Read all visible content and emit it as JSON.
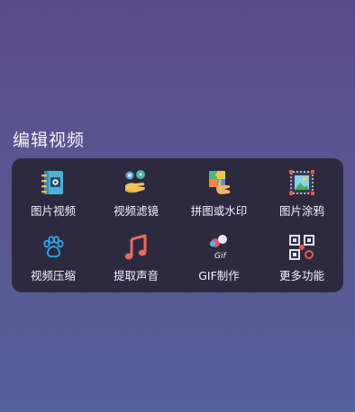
{
  "section": {
    "title": "编辑视频"
  },
  "tools": [
    {
      "label": "图片视频",
      "icon": "photo-album-icon"
    },
    {
      "label": "视频滤镜",
      "icon": "filter-hand-icon"
    },
    {
      "label": "拼图或水印",
      "icon": "puzzle-hand-icon"
    },
    {
      "label": "图片涂鸦",
      "icon": "framed-picture-icon"
    },
    {
      "label": "视频压缩",
      "icon": "paw-icon"
    },
    {
      "label": "提取声音",
      "icon": "music-note-icon"
    },
    {
      "label": "GIF制作",
      "icon": "gif-icon"
    },
    {
      "label": "更多功能",
      "icon": "qr-code-icon"
    }
  ],
  "gif_icon_text": "Gif",
  "colors": {
    "background_top": "#5a4a8c",
    "background_bottom": "#53609a",
    "panel": "#2d2a40"
  }
}
